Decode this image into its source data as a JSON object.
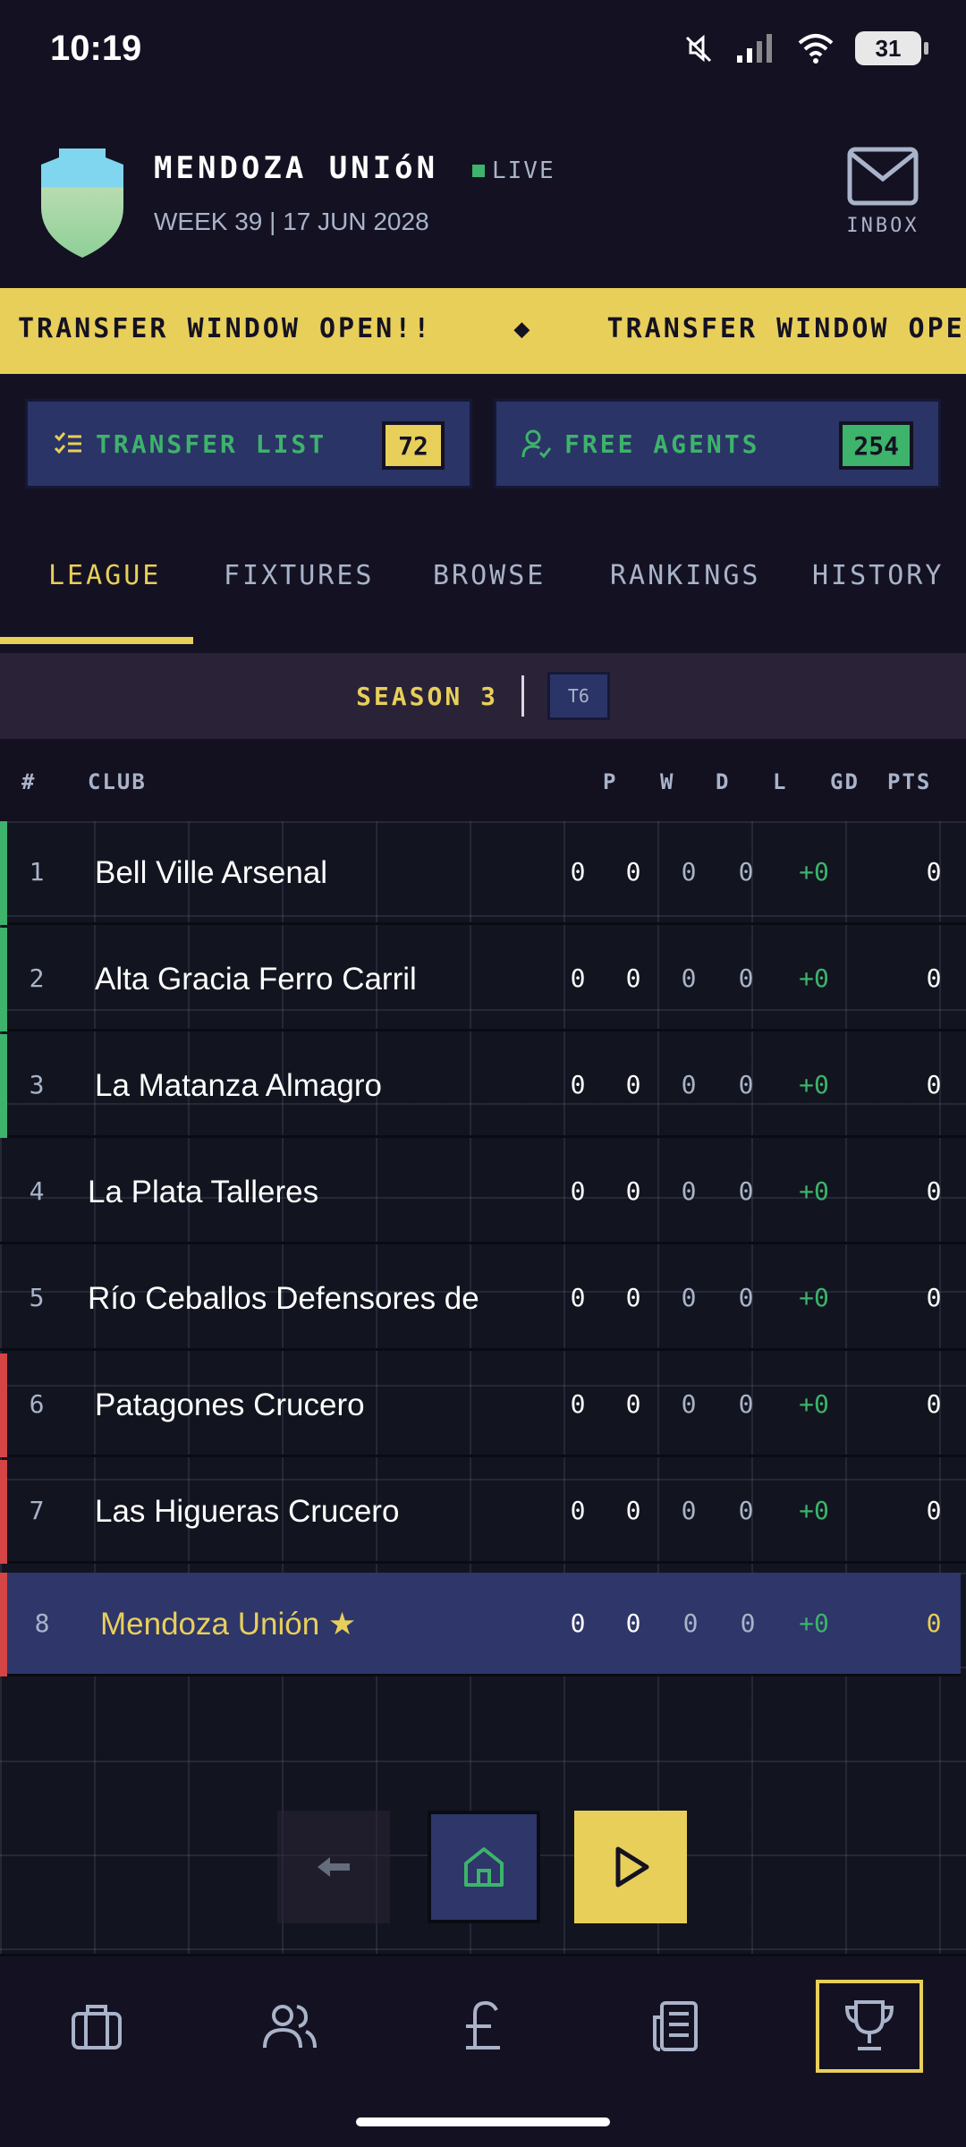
{
  "status_bar": {
    "time": "10:19",
    "battery": "31"
  },
  "header": {
    "club_name": "MENDOZA UNIóN",
    "live_label": "LIVE",
    "week_line": "WEEK 39  |  17 JUN 2028",
    "inbox_label": "INBOX"
  },
  "ticker": {
    "message": "TRANSFER WINDOW OPEN!!",
    "separator": "◆",
    "message_repeat": "TRANSFER WINDOW OPE"
  },
  "actions": {
    "transfer_list": {
      "label": "TRANSFER LIST",
      "count": "72"
    },
    "free_agents": {
      "label": "FREE AGENTS",
      "count": "254"
    }
  },
  "tabs": [
    {
      "label": "LEAGUE",
      "active": true
    },
    {
      "label": "FIXTURES"
    },
    {
      "label": "BROWSE"
    },
    {
      "label": "RANKINGS"
    },
    {
      "label": "HISTORY"
    }
  ],
  "season": {
    "label": "SEASON 3",
    "tier": "T6"
  },
  "table": {
    "headers": {
      "pos": "#",
      "club": "CLUB",
      "p": "P",
      "w": "W",
      "d": "D",
      "l": "L",
      "gd": "GD",
      "pts": "PTS"
    },
    "rows": [
      {
        "pos": "1",
        "club": "Bell Ville Arsenal",
        "p": "0",
        "w": "0",
        "d": "0",
        "l": "0",
        "gd": "+0",
        "pts": "0",
        "zone": "promotion"
      },
      {
        "pos": "2",
        "club": "Alta Gracia Ferro Carril",
        "p": "0",
        "w": "0",
        "d": "0",
        "l": "0",
        "gd": "+0",
        "pts": "0",
        "zone": "promotion"
      },
      {
        "pos": "3",
        "club": "La Matanza Almagro",
        "p": "0",
        "w": "0",
        "d": "0",
        "l": "0",
        "gd": "+0",
        "pts": "0",
        "zone": "promotion"
      },
      {
        "pos": "4",
        "club": "La Plata Talleres",
        "p": "0",
        "w": "0",
        "d": "0",
        "l": "0",
        "gd": "+0",
        "pts": "0",
        "zone": "none"
      },
      {
        "pos": "5",
        "club": "Río Ceballos Defensores de",
        "p": "0",
        "w": "0",
        "d": "0",
        "l": "0",
        "gd": "+0",
        "pts": "0",
        "zone": "none"
      },
      {
        "pos": "6",
        "club": "Patagones Crucero",
        "p": "0",
        "w": "0",
        "d": "0",
        "l": "0",
        "gd": "+0",
        "pts": "0",
        "zone": "relegation"
      },
      {
        "pos": "7",
        "club": "Las Higueras Crucero",
        "p": "0",
        "w": "0",
        "d": "0",
        "l": "0",
        "gd": "+0",
        "pts": "0",
        "zone": "relegation"
      },
      {
        "pos": "8",
        "club": "Mendoza Unión ★",
        "p": "0",
        "w": "0",
        "d": "0",
        "l": "0",
        "gd": "+0",
        "pts": "0",
        "zone": "relegation",
        "current": true
      }
    ]
  },
  "controls": {
    "back_icon": "back-arrow-icon",
    "home_icon": "home-icon",
    "play_icon": "play-icon"
  },
  "bottom_nav": [
    {
      "icon": "briefcase-icon"
    },
    {
      "icon": "users-icon"
    },
    {
      "icon": "pound-icon"
    },
    {
      "icon": "news-icon"
    },
    {
      "icon": "trophy-icon",
      "active": true
    }
  ],
  "colors": {
    "background": "#141222",
    "accent_yellow": "#e8cf5a",
    "accent_green": "#3db36b",
    "navy": "#2e366a",
    "relegation_red": "#d54545",
    "muted_text": "#a9b3c9"
  }
}
